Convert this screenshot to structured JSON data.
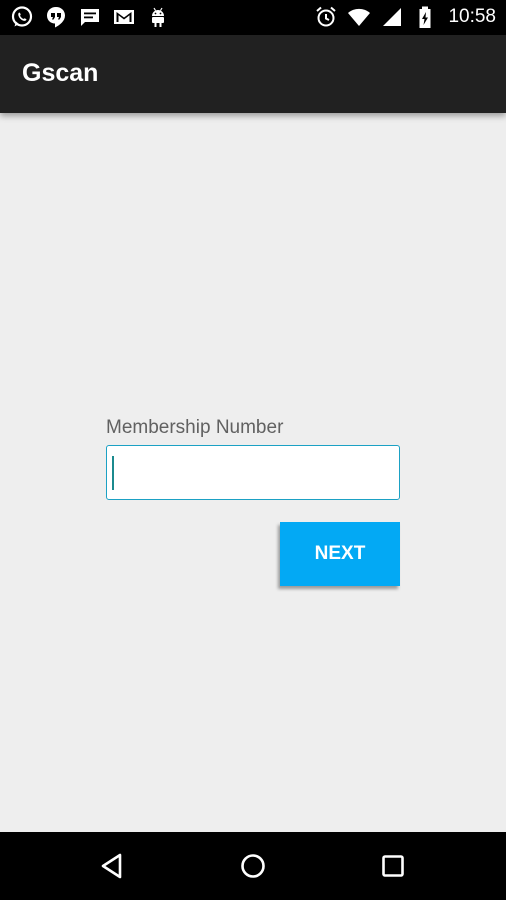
{
  "status_bar": {
    "time": "10:58",
    "left_icons": [
      "whatsapp-icon",
      "hangouts-icon",
      "message-icon",
      "gmail-icon",
      "android-icon"
    ],
    "right_icons": [
      "alarm-icon",
      "wifi-icon",
      "signal-icon",
      "battery-charging-icon"
    ]
  },
  "app_bar": {
    "title": "Gscan",
    "background": "#212121"
  },
  "form": {
    "label": "Membership Number",
    "input_value": "",
    "input_border_color": "#1ba1c4",
    "next_label": "NEXT",
    "next_color": "#03a9f4"
  },
  "nav_bar": {
    "buttons": [
      "back-icon",
      "home-icon",
      "recents-icon"
    ]
  }
}
